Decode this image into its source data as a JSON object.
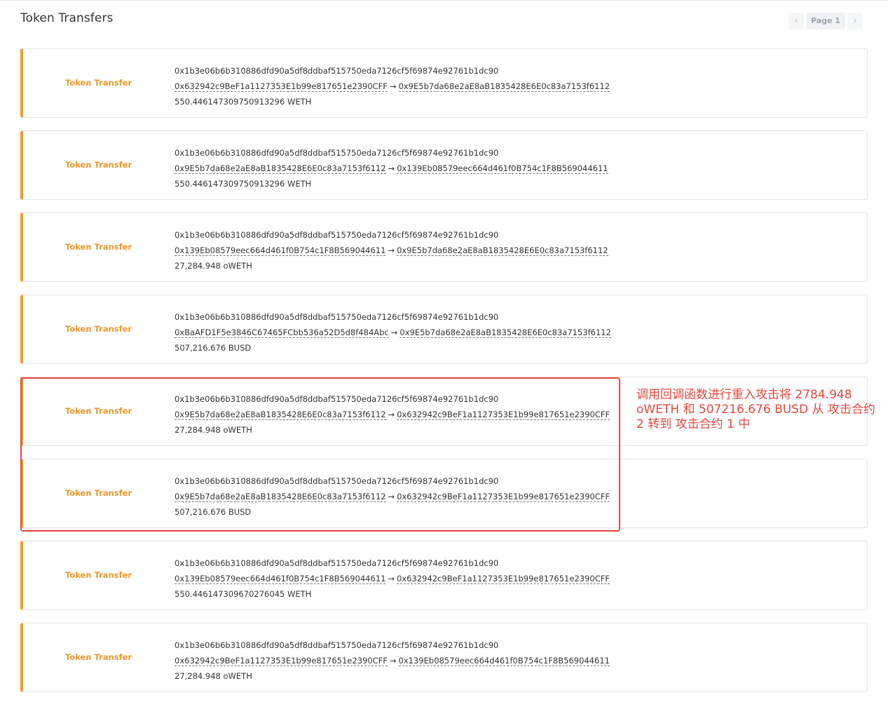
{
  "header": {
    "title": "Token Transfers",
    "pagination": {
      "prev_icon": "chevron-left-icon",
      "label": "Page 1",
      "next_icon": "chevron-right-icon"
    }
  },
  "transfers": [
    {
      "type": "Token Transfer",
      "tx_hash": "0x1b3e06b6b310886dfd90a5df8ddbaf515750eda7126cf5f69874e92761b1dc90",
      "from": "0x632942c9BeF1a1127353E1b99e817651e2390CFF",
      "to": "0x9E5b7da68e2aE8aB1835428E6E0c83a7153f6112",
      "amount": "550.446147309750913296 WETH"
    },
    {
      "type": "Token Transfer",
      "tx_hash": "0x1b3e06b6b310886dfd90a5df8ddbaf515750eda7126cf5f69874e92761b1dc90",
      "from": "0x9E5b7da68e2aE8aB1835428E6E0c83a7153f6112",
      "to": "0x139Eb08579eec664d461f0B754c1F8B569044611",
      "amount": "550.446147309750913296 WETH"
    },
    {
      "type": "Token Transfer",
      "tx_hash": "0x1b3e06b6b310886dfd90a5df8ddbaf515750eda7126cf5f69874e92761b1dc90",
      "from": "0x139Eb08579eec664d461f0B754c1F8B569044611",
      "to": "0x9E5b7da68e2aE8aB1835428E6E0c83a7153f6112",
      "amount": "27,284.948 oWETH"
    },
    {
      "type": "Token Transfer",
      "tx_hash": "0x1b3e06b6b310886dfd90a5df8ddbaf515750eda7126cf5f69874e92761b1dc90",
      "from": "0xBaAFD1F5e3846C67465FCbb536a52D5d8f484Abc",
      "to": "0x9E5b7da68e2aE8aB1835428E6E0c83a7153f6112",
      "amount": "507,216.676 BUSD"
    },
    {
      "type": "Token Transfer",
      "tx_hash": "0x1b3e06b6b310886dfd90a5df8ddbaf515750eda7126cf5f69874e92761b1dc90",
      "from": "0x9E5b7da68e2aE8aB1835428E6E0c83a7153f6112",
      "to": "0x632942c9BeF1a1127353E1b99e817651e2390CFF",
      "amount": "27,284.948 oWETH"
    },
    {
      "type": "Token Transfer",
      "tx_hash": "0x1b3e06b6b310886dfd90a5df8ddbaf515750eda7126cf5f69874e92761b1dc90",
      "from": "0x9E5b7da68e2aE8aB1835428E6E0c83a7153f6112",
      "to": "0x632942c9BeF1a1127353E1b99e817651e2390CFF",
      "amount": "507,216.676 BUSD"
    },
    {
      "type": "Token Transfer",
      "tx_hash": "0x1b3e06b6b310886dfd90a5df8ddbaf515750eda7126cf5f69874e92761b1dc90",
      "from": "0x139Eb08579eec664d461f0B754c1F8B569044611",
      "to": "0x632942c9BeF1a1127353E1b99e817651e2390CFF",
      "amount": "550.446147309670276045 WETH"
    },
    {
      "type": "Token Transfer",
      "tx_hash": "0x1b3e06b6b310886dfd90a5df8ddbaf515750eda7126cf5f69874e92761b1dc90",
      "from": "0x632942c9BeF1a1127353E1b99e817651e2390CFF",
      "to": "0x139Eb08579eec664d461f0B754c1F8B569044611",
      "amount": "27,284.948 oWETH"
    }
  ],
  "arrow": "→",
  "annotation": {
    "text": "调用回调函数进行重入攻击将 2784.948 oWETH 和 507216.676 BUSD 从 攻击合约 2 转到 攻击合约 1 中",
    "color": "#e8463d"
  },
  "colors": {
    "accent": "#f29a2e",
    "highlight": "#e8463d"
  }
}
